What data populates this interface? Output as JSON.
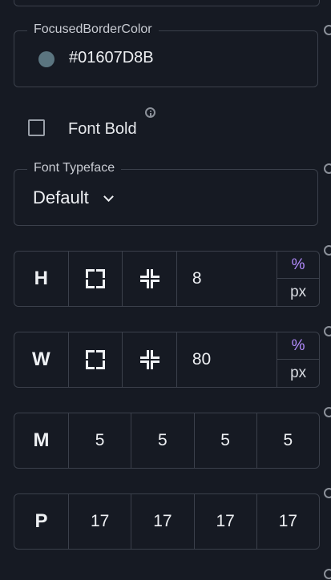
{
  "focused_border_color": {
    "label": "FocusedBorderColor",
    "swatch_color": "#5b7580",
    "value": "#01607D8B"
  },
  "font_bold": {
    "label": "Font Bold",
    "checked": false
  },
  "font_typeface": {
    "label": "Font Typeface",
    "value": "Default"
  },
  "height": {
    "label": "H",
    "value": "8",
    "unit_percent": "%",
    "unit_px": "px"
  },
  "width": {
    "label": "W",
    "value": "80",
    "unit_percent": "%",
    "unit_px": "px"
  },
  "margin": {
    "label": "M",
    "values": [
      "5",
      "5",
      "5",
      "5"
    ]
  },
  "padding": {
    "label": "P",
    "values": [
      "17",
      "17",
      "17",
      "17"
    ]
  },
  "colors": {
    "background": "#161a23",
    "border": "#3b404b",
    "accent_percent": "#b48cff"
  }
}
